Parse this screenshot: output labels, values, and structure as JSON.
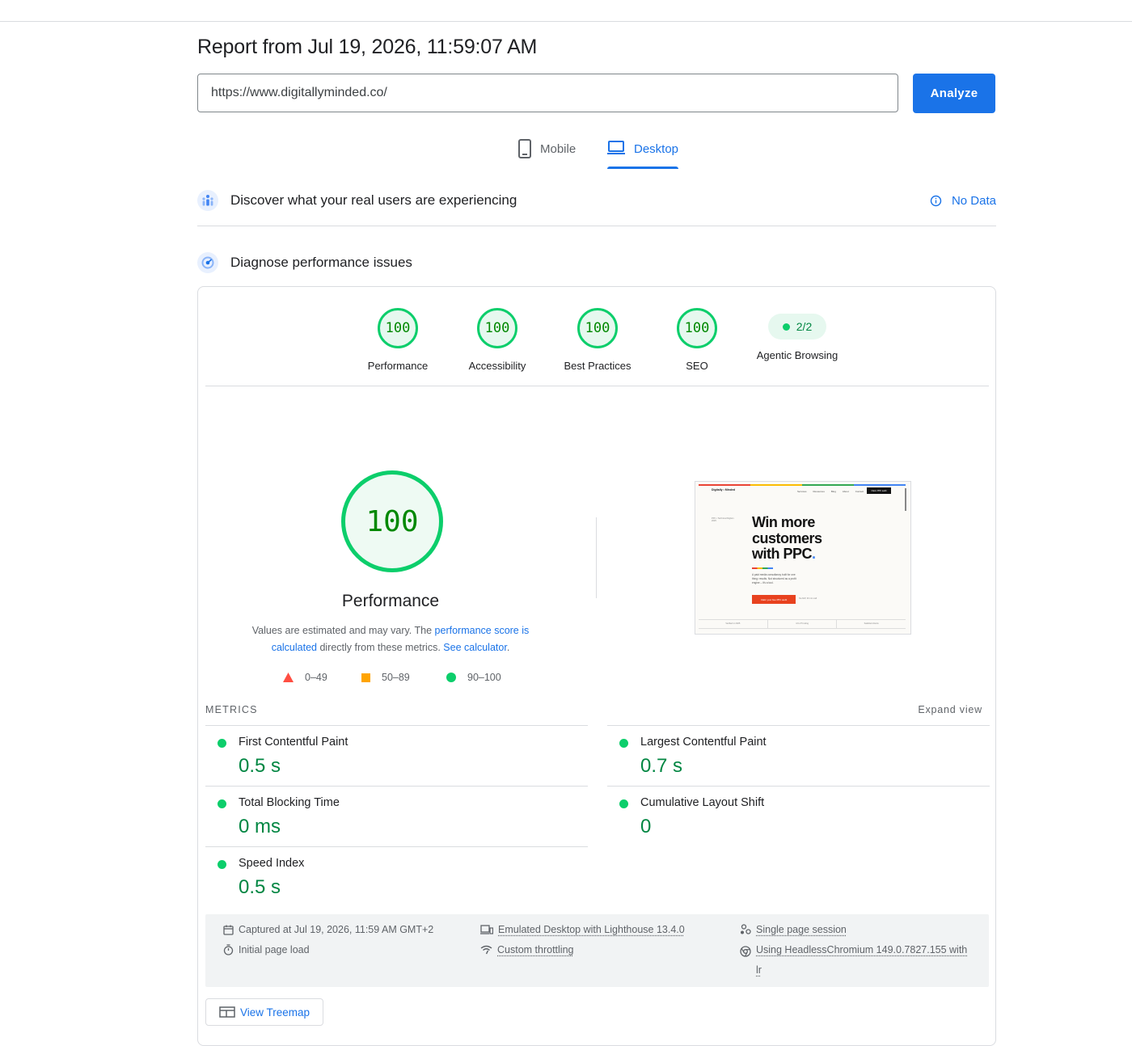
{
  "report": {
    "title": "Report from Jul 19, 2026, 11:59:07 AM",
    "url": "https://www.digitallyminded.co/",
    "analyze_label": "Analyze"
  },
  "tabs": {
    "mobile": "Mobile",
    "desktop": "Desktop",
    "selected": "desktop"
  },
  "field_section": {
    "title": "Discover what your real users are experiencing",
    "status": "No Data"
  },
  "lab_section": {
    "title": "Diagnose performance issues"
  },
  "categories": [
    {
      "label": "Performance",
      "score": "100"
    },
    {
      "label": "Accessibility",
      "score": "100"
    },
    {
      "label": "Best Practices",
      "score": "100"
    },
    {
      "label": "SEO",
      "score": "100"
    },
    {
      "label": "Agentic Browsing",
      "score": "2/2"
    }
  ],
  "performance": {
    "score": "100",
    "label": "Performance",
    "desc_1": "Values are estimated and may vary. The ",
    "desc_link_1": "performance score is calculated",
    "desc_2": " directly from these metrics. ",
    "desc_link_2": "See calculator",
    "desc_3": ".",
    "legend": {
      "poor": "0–49",
      "average": "50–89",
      "good": "90–100"
    }
  },
  "preview": {
    "logo": "Digitally • Minded",
    "nav": [
      "Services",
      "Resources",
      "Blog",
      "About",
      "Contact"
    ],
    "nav_cta": "Claim PPC audit",
    "eyebrow": "PPC • Technical Digital • 2025",
    "headline_1": "Win more",
    "headline_2": "customers",
    "headline_3": "with PPC",
    "body": "A paid media consultancy built for one thing: results. Not structured as a profit engine – it's a tool.",
    "cta": "Claim your free PPC audit",
    "cta_note": "No-fluff, 30 min call",
    "footer": [
      "Verified in 2025",
      "4.9 of 5 rating",
      "Satisfied clients"
    ]
  },
  "metrics": {
    "header": "METRICS",
    "expand": "Expand view",
    "items": [
      {
        "name": "First Contentful Paint",
        "value": "0.5 s"
      },
      {
        "name": "Largest Contentful Paint",
        "value": "0.7 s"
      },
      {
        "name": "Total Blocking Time",
        "value": "0 ms"
      },
      {
        "name": "Cumulative Layout Shift",
        "value": "0"
      },
      {
        "name": "Speed Index",
        "value": "0.5 s"
      }
    ]
  },
  "run_info": {
    "captured": "Captured at Jul 19, 2026, 11:59 AM GMT+2",
    "load": "Initial page load",
    "emulated": "Emulated Desktop with Lighthouse 13.4.0",
    "throttling": "Custom throttling",
    "session": "Single page session",
    "browser_1": "Using HeadlessChromium 149.0.7827.155 with",
    "browser_2": "lr"
  },
  "treemap_label": "View Treemap",
  "colors": {
    "accent": "#1a73e8",
    "pass": "#0cce6b",
    "pass_text": "#018642",
    "average": "#ffa400",
    "fail": "#ff4e42"
  }
}
